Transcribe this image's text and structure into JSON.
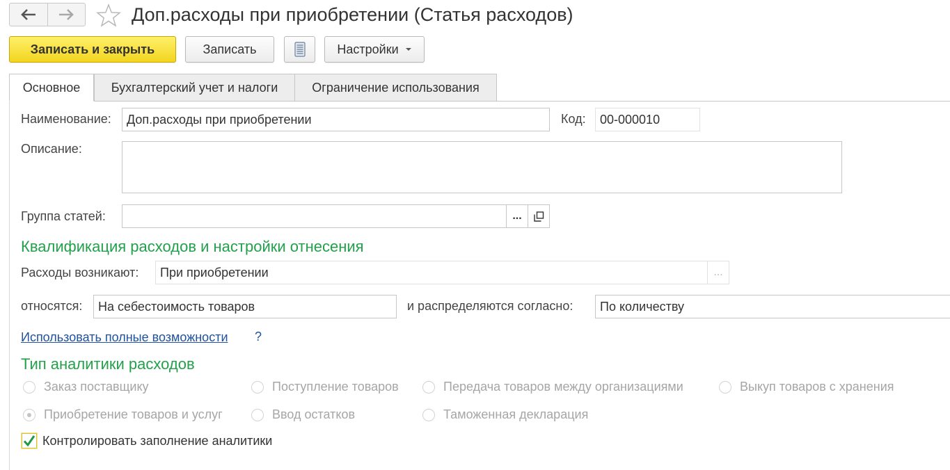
{
  "window": {
    "title": "Доп.расходы при приобретении (Статья расходов)"
  },
  "toolbar": {
    "save_close_label": "Записать и закрыть",
    "save_label": "Записать",
    "settings_label": "Настройки"
  },
  "tabs": [
    {
      "label": "Основное",
      "active": true
    },
    {
      "label": "Бухгалтерский учет и налоги",
      "active": false
    },
    {
      "label": "Ограничение использования",
      "active": false
    }
  ],
  "form": {
    "name_label": "Наименование:",
    "name_value": "Доп.расходы при приобретении",
    "code_label": "Код:",
    "code_value": "00-000010",
    "description_label": "Описание:",
    "description_value": "",
    "group_label": "Группа статей:",
    "group_value": "",
    "select_ellipsis": "...",
    "section_qualification": "Квалификация расходов и настройки отнесения",
    "arise_label": "Расходы возникают:",
    "arise_value": "При приобретении",
    "relate_label": "относятся:",
    "relate_value": "На себестоимость товаров",
    "distribute_label": "и распределяются согласно:",
    "distribute_value": "По количеству",
    "full_features_link": "Использовать полные возможности",
    "help_mark": "?",
    "section_analytics": "Тип аналитики расходов",
    "radio_options": [
      {
        "label": "Заказ поставщику",
        "selected": false
      },
      {
        "label": "Поступление товаров",
        "selected": false
      },
      {
        "label": "Передача товаров между организациями",
        "selected": false
      },
      {
        "label": "Выкуп товаров с хранения",
        "selected": false
      },
      {
        "label": "Приобретение товаров и услуг",
        "selected": true
      },
      {
        "label": "Ввод остатков",
        "selected": false
      },
      {
        "label": "Таможенная декларация",
        "selected": false
      }
    ],
    "control_checkbox_label": "Контролировать заполнение аналитики",
    "control_checked": true
  },
  "colors": {
    "accent_yellow": "#f5d91f",
    "section_green": "#23a04b",
    "link_blue": "#1f52a1"
  }
}
